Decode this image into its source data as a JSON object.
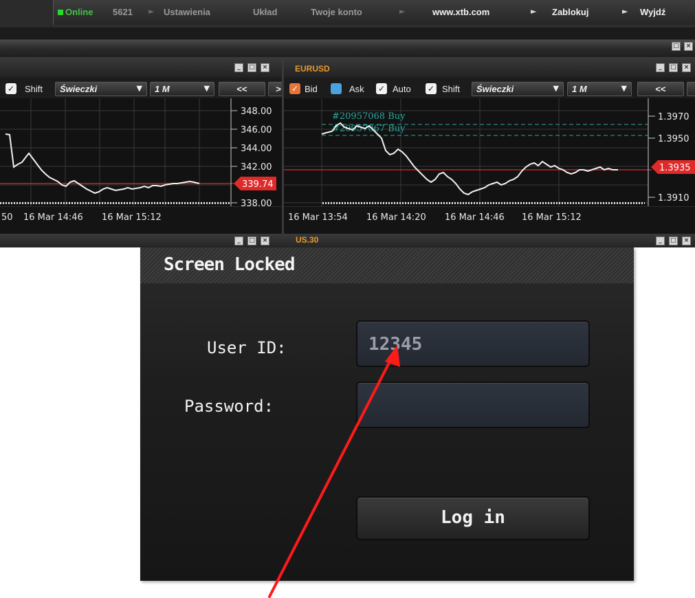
{
  "top_menu": {
    "status": "Online",
    "account_number": "5621",
    "items": [
      "Ustawienia",
      "Układ",
      "Twoje konto",
      "www.xtb.com",
      "Zablokuj",
      "Wyjdź"
    ]
  },
  "chart_left": {
    "toolbar": {
      "shift_label": "Shift",
      "chart_type": "Świeczki",
      "timeframe": "1 M",
      "nav_prev": "<<",
      "nav_next": ">"
    },
    "price_labels": [
      "348.00",
      "346.00",
      "344.00",
      "342.00",
      "338.00"
    ],
    "current_price": "339.74",
    "time_labels": [
      "50",
      "16 Mar 14:46",
      "16 Mar 15:12"
    ]
  },
  "chart_right": {
    "title": "EURUSD",
    "toolbar": {
      "bid_label": "Bid",
      "ask_label": "Ask",
      "auto_label": "Auto",
      "shift_label": "Shift",
      "chart_type": "Świeczki",
      "timeframe": "1 M",
      "nav_prev": "<<"
    },
    "order_labels": [
      "#20957068 Buy",
      "#20957067 Buy"
    ],
    "price_labels": [
      "1.3970",
      "1.3950",
      "1.3910"
    ],
    "current_price": "1.3935",
    "time_labels": [
      "16 Mar 13:54",
      "16 Mar 14:20",
      "16 Mar 14:46",
      "16 Mar 15:12"
    ]
  },
  "second_row": {
    "right_title": "US.30"
  },
  "lock_dialog": {
    "title": "Screen Locked",
    "user_id_label": "User ID:",
    "user_id_value": "12345",
    "password_label": "Password:",
    "password_value": "",
    "login_button": "Log in"
  },
  "colors": {
    "accent_orange": "#e89a2b",
    "price_marker_red": "#e02a2a",
    "annotation_arrow": "#ff1a1a",
    "order_line_teal": "#2aa8a0"
  },
  "icons": [
    "minimize-icon",
    "maximize-icon",
    "close-icon",
    "chevron-down-icon",
    "checkmark-icon"
  ]
}
